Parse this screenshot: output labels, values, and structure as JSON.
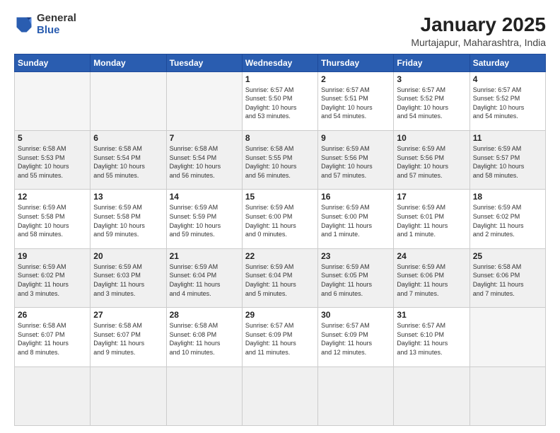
{
  "logo": {
    "general": "General",
    "blue": "Blue"
  },
  "title": "January 2025",
  "location": "Murtajapur, Maharashtra, India",
  "weekdays": [
    "Sunday",
    "Monday",
    "Tuesday",
    "Wednesday",
    "Thursday",
    "Friday",
    "Saturday"
  ],
  "days": [
    {
      "num": "",
      "info": "",
      "empty": true
    },
    {
      "num": "",
      "info": "",
      "empty": true
    },
    {
      "num": "",
      "info": "",
      "empty": true
    },
    {
      "num": "1",
      "info": "Sunrise: 6:57 AM\nSunset: 5:50 PM\nDaylight: 10 hours\nand 53 minutes."
    },
    {
      "num": "2",
      "info": "Sunrise: 6:57 AM\nSunset: 5:51 PM\nDaylight: 10 hours\nand 54 minutes."
    },
    {
      "num": "3",
      "info": "Sunrise: 6:57 AM\nSunset: 5:52 PM\nDaylight: 10 hours\nand 54 minutes."
    },
    {
      "num": "4",
      "info": "Sunrise: 6:57 AM\nSunset: 5:52 PM\nDaylight: 10 hours\nand 54 minutes."
    },
    {
      "num": "5",
      "info": "Sunrise: 6:58 AM\nSunset: 5:53 PM\nDaylight: 10 hours\nand 55 minutes."
    },
    {
      "num": "6",
      "info": "Sunrise: 6:58 AM\nSunset: 5:54 PM\nDaylight: 10 hours\nand 55 minutes."
    },
    {
      "num": "7",
      "info": "Sunrise: 6:58 AM\nSunset: 5:54 PM\nDaylight: 10 hours\nand 56 minutes."
    },
    {
      "num": "8",
      "info": "Sunrise: 6:58 AM\nSunset: 5:55 PM\nDaylight: 10 hours\nand 56 minutes."
    },
    {
      "num": "9",
      "info": "Sunrise: 6:59 AM\nSunset: 5:56 PM\nDaylight: 10 hours\nand 57 minutes."
    },
    {
      "num": "10",
      "info": "Sunrise: 6:59 AM\nSunset: 5:56 PM\nDaylight: 10 hours\nand 57 minutes."
    },
    {
      "num": "11",
      "info": "Sunrise: 6:59 AM\nSunset: 5:57 PM\nDaylight: 10 hours\nand 58 minutes."
    },
    {
      "num": "12",
      "info": "Sunrise: 6:59 AM\nSunset: 5:58 PM\nDaylight: 10 hours\nand 58 minutes."
    },
    {
      "num": "13",
      "info": "Sunrise: 6:59 AM\nSunset: 5:58 PM\nDaylight: 10 hours\nand 59 minutes."
    },
    {
      "num": "14",
      "info": "Sunrise: 6:59 AM\nSunset: 5:59 PM\nDaylight: 10 hours\nand 59 minutes."
    },
    {
      "num": "15",
      "info": "Sunrise: 6:59 AM\nSunset: 6:00 PM\nDaylight: 11 hours\nand 0 minutes."
    },
    {
      "num": "16",
      "info": "Sunrise: 6:59 AM\nSunset: 6:00 PM\nDaylight: 11 hours\nand 1 minute."
    },
    {
      "num": "17",
      "info": "Sunrise: 6:59 AM\nSunset: 6:01 PM\nDaylight: 11 hours\nand 1 minute."
    },
    {
      "num": "18",
      "info": "Sunrise: 6:59 AM\nSunset: 6:02 PM\nDaylight: 11 hours\nand 2 minutes."
    },
    {
      "num": "19",
      "info": "Sunrise: 6:59 AM\nSunset: 6:02 PM\nDaylight: 11 hours\nand 3 minutes."
    },
    {
      "num": "20",
      "info": "Sunrise: 6:59 AM\nSunset: 6:03 PM\nDaylight: 11 hours\nand 3 minutes."
    },
    {
      "num": "21",
      "info": "Sunrise: 6:59 AM\nSunset: 6:04 PM\nDaylight: 11 hours\nand 4 minutes."
    },
    {
      "num": "22",
      "info": "Sunrise: 6:59 AM\nSunset: 6:04 PM\nDaylight: 11 hours\nand 5 minutes."
    },
    {
      "num": "23",
      "info": "Sunrise: 6:59 AM\nSunset: 6:05 PM\nDaylight: 11 hours\nand 6 minutes."
    },
    {
      "num": "24",
      "info": "Sunrise: 6:59 AM\nSunset: 6:06 PM\nDaylight: 11 hours\nand 7 minutes."
    },
    {
      "num": "25",
      "info": "Sunrise: 6:58 AM\nSunset: 6:06 PM\nDaylight: 11 hours\nand 7 minutes."
    },
    {
      "num": "26",
      "info": "Sunrise: 6:58 AM\nSunset: 6:07 PM\nDaylight: 11 hours\nand 8 minutes."
    },
    {
      "num": "27",
      "info": "Sunrise: 6:58 AM\nSunset: 6:07 PM\nDaylight: 11 hours\nand 9 minutes."
    },
    {
      "num": "28",
      "info": "Sunrise: 6:58 AM\nSunset: 6:08 PM\nDaylight: 11 hours\nand 10 minutes."
    },
    {
      "num": "29",
      "info": "Sunrise: 6:57 AM\nSunset: 6:09 PM\nDaylight: 11 hours\nand 11 minutes."
    },
    {
      "num": "30",
      "info": "Sunrise: 6:57 AM\nSunset: 6:09 PM\nDaylight: 11 hours\nand 12 minutes."
    },
    {
      "num": "31",
      "info": "Sunrise: 6:57 AM\nSunset: 6:10 PM\nDaylight: 11 hours\nand 13 minutes."
    },
    {
      "num": "",
      "info": "",
      "empty": true
    },
    {
      "num": "",
      "info": "",
      "empty": true
    },
    {
      "num": "",
      "info": "",
      "empty": true
    },
    {
      "num": "",
      "info": "",
      "empty": true
    },
    {
      "num": "",
      "info": "",
      "empty": true
    }
  ]
}
